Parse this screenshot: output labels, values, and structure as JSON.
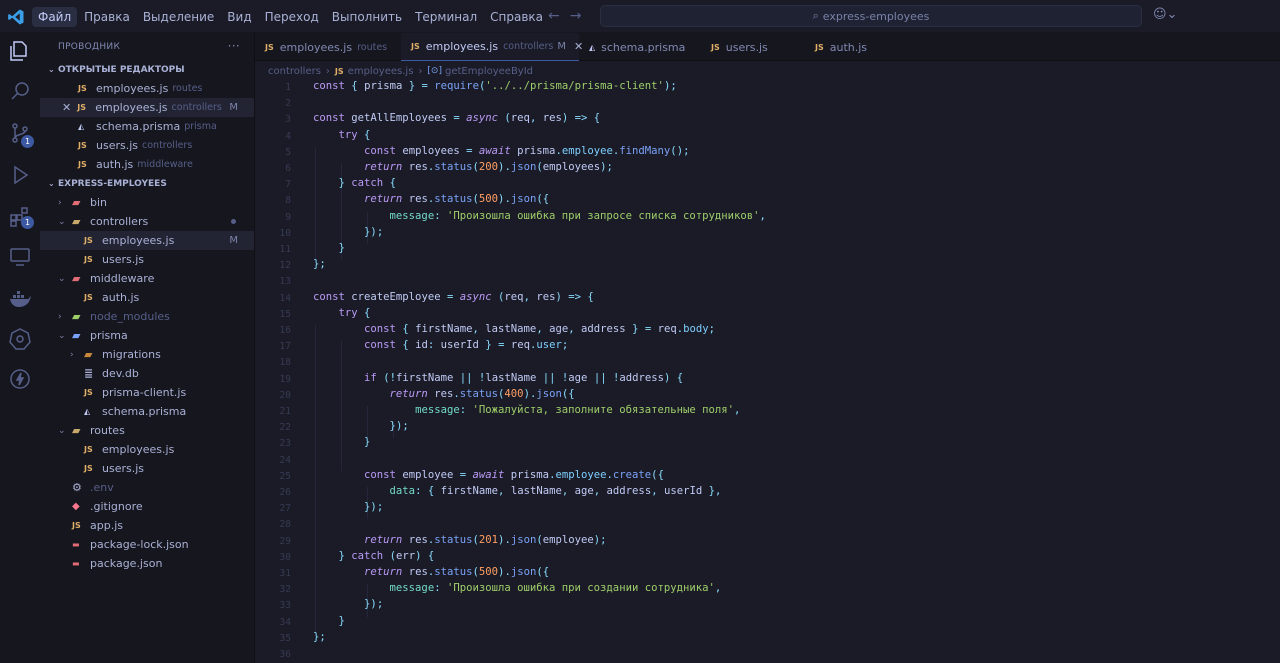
{
  "menu": [
    "Файл",
    "Правка",
    "Выделение",
    "Вид",
    "Переход",
    "Выполнить",
    "Терминал",
    "Справка"
  ],
  "search": "express-employees",
  "sidebar": {
    "title": "ПРОВОДНИК",
    "open_editors_title": "ОТКРЫТЫЕ РЕДАКТОРЫ",
    "open_editors": [
      {
        "icon": "JS",
        "name": "employees.js",
        "desc": "routes",
        "mark": ""
      },
      {
        "icon": "JS",
        "name": "employees.js",
        "desc": "controllers",
        "mark": "M"
      },
      {
        "icon": "prisma",
        "name": "schema.prisma",
        "desc": "prisma",
        "mark": ""
      },
      {
        "icon": "JS",
        "name": "users.js",
        "desc": "controllers",
        "mark": ""
      },
      {
        "icon": "JS",
        "name": "auth.js",
        "desc": "middleware",
        "mark": ""
      }
    ],
    "project_title": "EXPRESS-EMPLOYEES",
    "tree": [
      {
        "name": "bin",
        "type": "folder",
        "depth": 0,
        "open": false
      },
      {
        "name": "controllers",
        "type": "folder",
        "depth": 0,
        "open": true
      },
      {
        "name": "employees.js",
        "type": "js",
        "depth": 1,
        "mark": "M"
      },
      {
        "name": "users.js",
        "type": "js",
        "depth": 1
      },
      {
        "name": "middleware",
        "type": "folder",
        "depth": 0,
        "open": true
      },
      {
        "name": "auth.js",
        "type": "js",
        "depth": 1
      },
      {
        "name": "node_modules",
        "type": "folder",
        "depth": 0,
        "open": false
      },
      {
        "name": "prisma",
        "type": "folder",
        "depth": 0,
        "open": true
      },
      {
        "name": "migrations",
        "type": "folder",
        "depth": 1,
        "open": false
      },
      {
        "name": "dev.db",
        "type": "db",
        "depth": 1
      },
      {
        "name": "prisma-client.js",
        "type": "js",
        "depth": 1
      },
      {
        "name": "schema.prisma",
        "type": "prisma",
        "depth": 1
      },
      {
        "name": "routes",
        "type": "folder",
        "depth": 0,
        "open": true
      },
      {
        "name": "employees.js",
        "type": "js",
        "depth": 1
      },
      {
        "name": "users.js",
        "type": "js",
        "depth": 1
      },
      {
        "name": ".env",
        "type": "env",
        "depth": 0
      },
      {
        "name": ".gitignore",
        "type": "git",
        "depth": 0
      },
      {
        "name": "app.js",
        "type": "js",
        "depth": 0
      },
      {
        "name": "package-lock.json",
        "type": "json",
        "depth": 0
      },
      {
        "name": "package.json",
        "type": "json",
        "depth": 0
      }
    ]
  },
  "tabs": [
    {
      "icon": "JS",
      "name": "employees.js",
      "desc": "routes"
    },
    {
      "icon": "JS",
      "name": "employees.js",
      "desc": "controllers",
      "mark": "M",
      "active": true
    },
    {
      "icon": "prisma",
      "name": "schema.prisma",
      "desc": ""
    },
    {
      "icon": "JS",
      "name": "users.js",
      "desc": ""
    },
    {
      "icon": "JS",
      "name": "auth.js",
      "desc": ""
    }
  ],
  "breadcrumb": {
    "folder": "controllers",
    "file": "employees.js",
    "symbol": "getEmployeeById"
  },
  "badges": {
    "scm": "1",
    "extensions": "1"
  },
  "code": [
    "const { prisma } = require('../../prisma/prisma-client');",
    "",
    "const getAllEmployees = async (req, res) => {",
    "    try {",
    "        const employees = await prisma.employee.findMany();",
    "        return res.status(200).json(employees);",
    "    } catch {",
    "        return res.status(500).json({",
    "            message: 'Произошла ошибка при запросе списка сотрудников',",
    "        });",
    "    }",
    "};",
    "",
    "const createEmployee = async (req, res) => {",
    "    try {",
    "        const { firstName, lastName, age, address } = req.body;",
    "        const { id: userId } = req.user;",
    "",
    "        if (!firstName || !lastName || !age || !address) {",
    "            return res.status(400).json({",
    "                message: 'Пожалуйста, заполните обязательные поля',",
    "            });",
    "        }",
    "",
    "        const employee = await prisma.employee.create({",
    "            data: { firstName, lastName, age, address, userId },",
    "        });",
    "",
    "        return res.status(201).json(employee);",
    "    } catch (err) {",
    "        return res.status(500).json({",
    "            message: 'Произошла ошибка при создании сотрудника',",
    "        });",
    "    }",
    "};",
    ""
  ]
}
